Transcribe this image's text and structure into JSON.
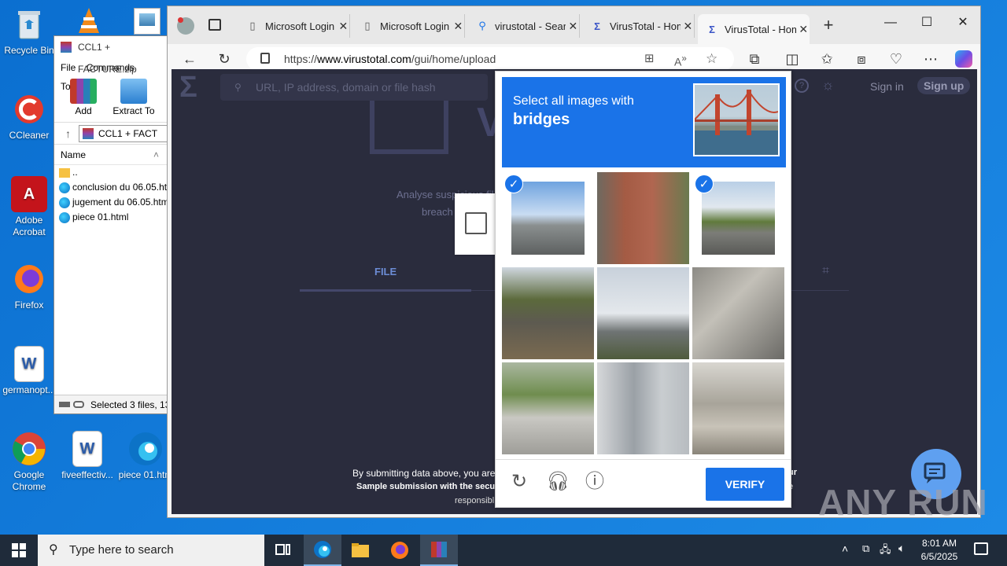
{
  "desktop": {
    "icons": [
      {
        "label": "Recycle Bin"
      },
      {
        "label": "CCleaner"
      },
      {
        "label": "Adobe Acrobat"
      },
      {
        "label": "Firefox"
      },
      {
        "label": "germanopt..."
      },
      {
        "label": "Google Chrome"
      },
      {
        "label": "fiveeffectiv..."
      },
      {
        "label": "piece 01.htm"
      }
    ]
  },
  "winrar": {
    "title": "CCL1 + FACTURE.zip",
    "menu": [
      "File",
      "Commands",
      "Tools"
    ],
    "tools": [
      {
        "label": "Add"
      },
      {
        "label": "Extract To"
      }
    ],
    "path": "CCL1 + FACT",
    "column_name": "Name",
    "files": [
      {
        "name": "..",
        "type": "folder"
      },
      {
        "name": "conclusion du 06.05.htm",
        "type": "html"
      },
      {
        "name": "jugement du 06.05.htm",
        "type": "html"
      },
      {
        "name": "piece 01.html",
        "type": "html"
      }
    ],
    "status": "Selected 3 files, 13,"
  },
  "browser": {
    "tabs": [
      {
        "label": "Microsoft Login",
        "icon": "document-icon"
      },
      {
        "label": "Microsoft Login",
        "icon": "document-icon"
      },
      {
        "label": "virustotal - Search",
        "icon": "search-icon"
      },
      {
        "label": "VirusTotal - Home",
        "icon": "virustotal-icon"
      },
      {
        "label": "VirusTotal - Home",
        "icon": "virustotal-icon",
        "active": true
      }
    ],
    "url_prefix": "https://",
    "url_host": "www.virustotal.com",
    "url_path": "/gui/home/upload"
  },
  "virustotal": {
    "search_placeholder": "URL, IP address, domain or file hash",
    "sign_in": "Sign in",
    "sign_up": "Sign up",
    "analyse": "Analyse suspicious fil",
    "breach": "breach",
    "file_tab": "FILE",
    "submit_line1": "By submitting data above, you are ag",
    "submit_line2": "Sample submission with the secur",
    "submit_line3": "responsibl",
    "submit_right1": "ur",
    "submit_right2": "e"
  },
  "captcha": {
    "instruction_line1": "Select all images with",
    "instruction_line2": "bridges",
    "verify_label": "VERIFY",
    "tiles": [
      {
        "selected": true
      },
      {
        "selected": false
      },
      {
        "selected": true
      },
      {
        "selected": false
      },
      {
        "selected": false
      },
      {
        "selected": false
      },
      {
        "selected": false
      },
      {
        "selected": false
      },
      {
        "selected": false
      }
    ]
  },
  "taskbar": {
    "search_placeholder": "Type here to search",
    "time": "8:01 AM",
    "date": "6/5/2025"
  },
  "watermark": "ANY RUN"
}
